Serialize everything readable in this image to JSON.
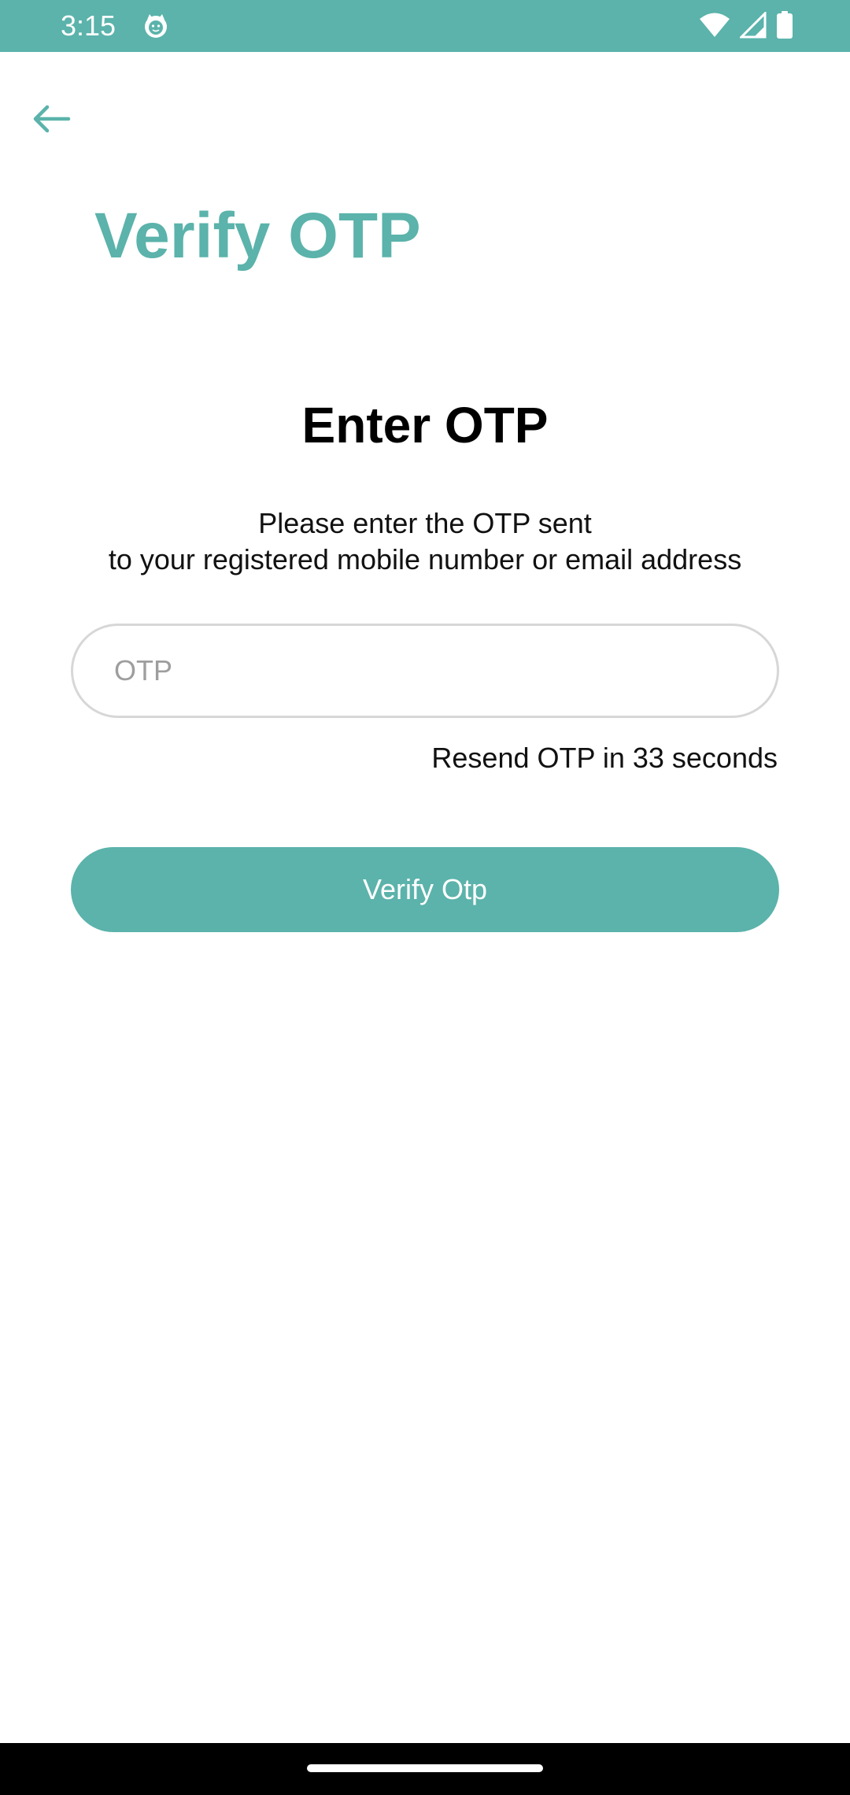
{
  "status_bar": {
    "time": "3:15",
    "background": "#5bb3ab",
    "app_icon": "cat-face-icon",
    "icons": [
      "wifi-icon",
      "signal-icon",
      "battery-icon"
    ]
  },
  "header": {
    "back_icon": "arrow-left-icon",
    "title": "Verify OTP"
  },
  "main": {
    "heading": "Enter OTP",
    "instruction_line1": "Please enter the OTP sent",
    "instruction_line2": "to your registered mobile number or email address",
    "otp_input": {
      "value": "",
      "placeholder": "OTP"
    },
    "resend_text": "Resend OTP in 33 seconds",
    "verify_button_label": "Verify Otp"
  },
  "colors": {
    "accent": "#5bb3ab",
    "field_border": "#d7d7d7",
    "placeholder": "#9e9e9e"
  }
}
